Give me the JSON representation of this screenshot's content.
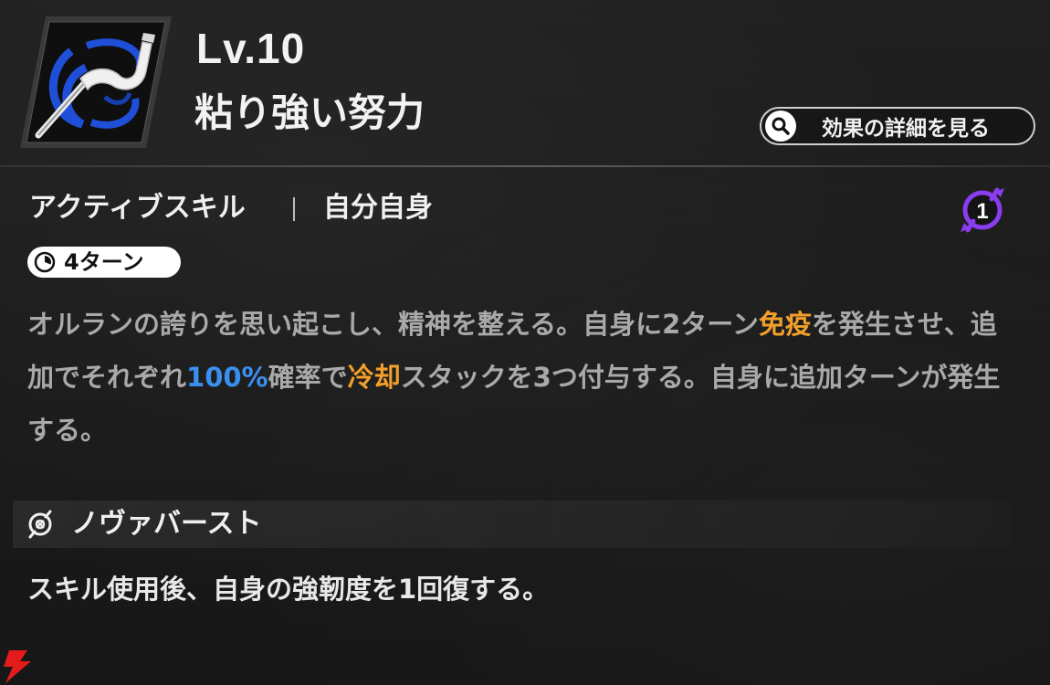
{
  "skill": {
    "level": "Lv.10",
    "name": "粘り強い努力",
    "icon": "sword-swirl-icon",
    "type": "アクティブスキル",
    "target": "自分自身",
    "cost": "1",
    "cooldown": "4ターン"
  },
  "detail_button": {
    "label": "効果の詳細を見る"
  },
  "description": {
    "p1": "オルランの誇りを思い起こし、精神を整える。自身に2ターン",
    "kw1": "免疫",
    "p2": "を発生させ、追加でそれぞれ",
    "pct": "100%",
    "p3": "確率で",
    "kw2": "冷却",
    "p4": "スタックを3つ付与する。自身に追加ターンが発生する。"
  },
  "nova_burst": {
    "title": "ノヴァバースト",
    "description": "スキル使用後、自身の強靭度を1回復する。"
  },
  "colors": {
    "background": "#1b1b1b",
    "keyword": "#f2a02a",
    "percent": "#3a8ff0",
    "cost_badge": "#8a3cf0",
    "icon_blue": "#1f4fd8"
  }
}
